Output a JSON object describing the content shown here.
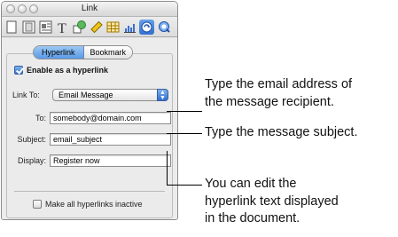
{
  "window": {
    "title": "Link",
    "toolbar_icons": [
      "document-icon",
      "layout-icon",
      "wrap-icon",
      "text-icon",
      "graphic-icon",
      "metrics-icon",
      "table-icon",
      "chart-icon",
      "hyperlink-icon",
      "quicktime-icon"
    ],
    "active_icon": "hyperlink-icon"
  },
  "tabs": [
    "Hyperlink",
    "Bookmark"
  ],
  "enable_hyperlink": {
    "label": "Enable as a hyperlink",
    "checked": true
  },
  "link_to": {
    "label": "Link To:",
    "value": "Email Message"
  },
  "to": {
    "label": "To:",
    "value": "somebody@domain.com"
  },
  "subject": {
    "label": "Subject:",
    "value": "email_subject"
  },
  "display": {
    "label": "Display:",
    "value": "Register now"
  },
  "inactive": {
    "label": "Make all hyperlinks inactive",
    "checked": false
  },
  "callouts": {
    "to_line1": "Type the email address of",
    "to_line2": "the message recipient.",
    "subject": "Type the message subject.",
    "display_line1": "You can edit the",
    "display_line2": "hyperlink text displayed",
    "display_line3": "in the document."
  },
  "colors": {
    "accent": "#2f6fd0",
    "tab_selected": "#5a9ae6"
  }
}
